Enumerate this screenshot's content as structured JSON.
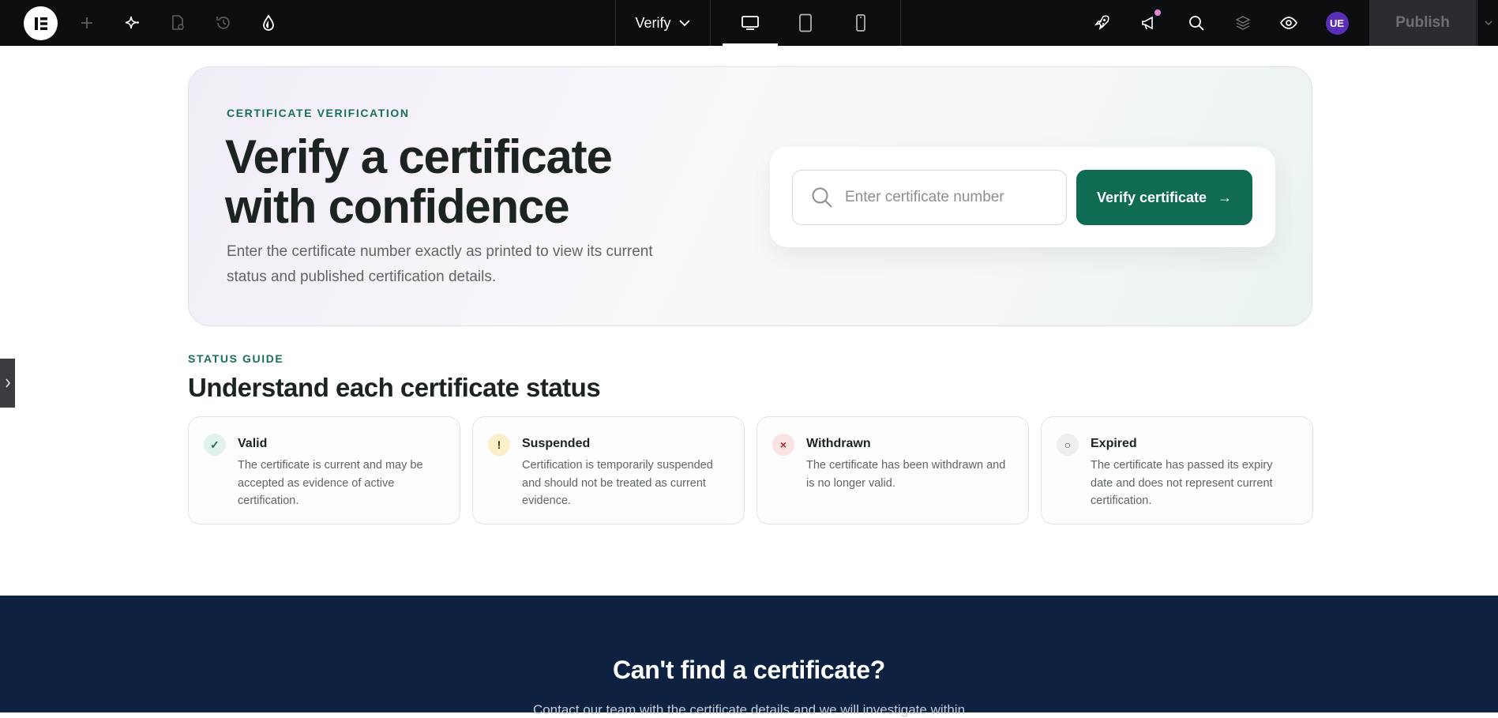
{
  "topbar": {
    "page_selector": "Verify",
    "avatar_initials": "UE",
    "publish_label": "Publish",
    "accent_badge_color": "#e08ad7"
  },
  "hero": {
    "eyebrow": "CERTIFICATE VERIFICATION",
    "title": "Verify a certificate with confidence",
    "subtitle": "Enter the certificate number exactly as printed to view its current status and published certification details.",
    "search_placeholder": "Enter certificate number",
    "search_value": "",
    "verify_button_label": "Verify certificate",
    "verify_button_arrow": "→",
    "accent_color": "#0f6b52"
  },
  "status_guide": {
    "eyebrow": "STATUS GUIDE",
    "title": "Understand each certificate status",
    "items": [
      {
        "icon": "check-icon",
        "glyph": "✓",
        "label": "Valid",
        "description": "The certificate is current and may be accepted as evidence of active certification.",
        "icon_bg": "#e1f3ea",
        "icon_color": "#1a6a50"
      },
      {
        "icon": "warning-icon",
        "glyph": "!",
        "label": "Suspended",
        "description": "Certification is temporarily suspended and should not be treated as current evidence.",
        "icon_bg": "#fbf0c9",
        "icon_color": "#3b3200"
      },
      {
        "icon": "x-icon",
        "glyph": "×",
        "label": "Withdrawn",
        "description": "The certificate has been withdrawn and is no longer valid.",
        "icon_bg": "#fbe3e3",
        "icon_color": "#b3262d"
      },
      {
        "icon": "circle-icon",
        "glyph": "○",
        "label": "Expired",
        "description": "The certificate has passed its expiry date and does not represent current certification.",
        "icon_bg": "#eeeeef",
        "icon_color": "#444"
      }
    ]
  },
  "cta": {
    "title": "Can't find a certificate?",
    "text": "Contact our team with the certificate details and we will investigate within"
  }
}
